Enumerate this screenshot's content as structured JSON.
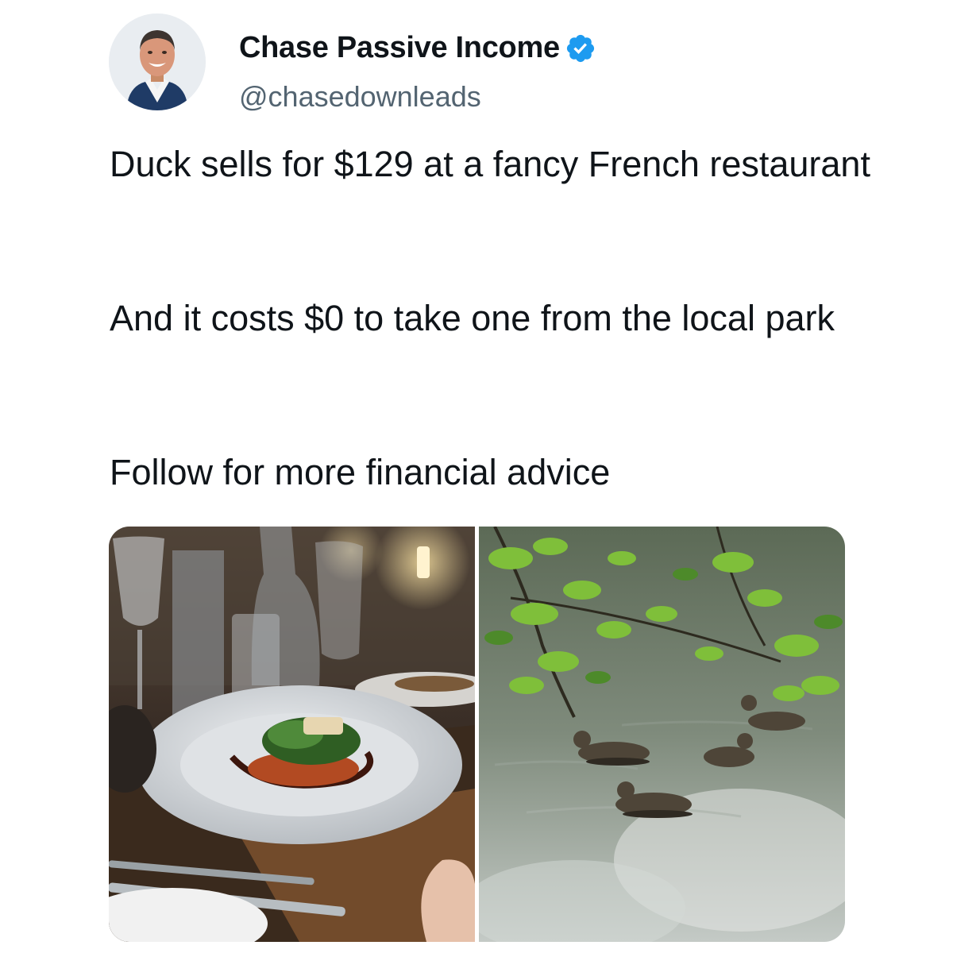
{
  "author": {
    "display_name": "Chase Passive Income",
    "handle": "@chasedownleads",
    "verified": true
  },
  "tweet": {
    "paragraphs": [
      "Duck sells for $129 at a fancy French restaurant",
      "And it costs $0 to take one from the local park",
      "Follow for more financial advice"
    ]
  },
  "media": [
    {
      "icon": "restaurant-dish-photo"
    },
    {
      "icon": "ducks-on-pond-photo"
    }
  ],
  "colors": {
    "verified": "#1d9bf0",
    "handle": "#536471",
    "text": "#0f1419"
  }
}
